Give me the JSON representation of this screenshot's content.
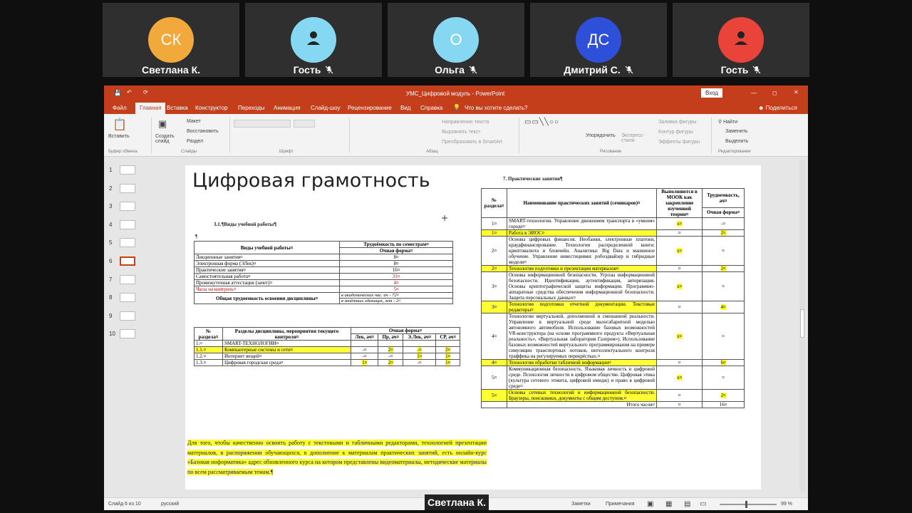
{
  "participants": [
    {
      "initials": "СК",
      "name": "Светлана К.",
      "color": "#f2a93b",
      "icon": "",
      "muted": false
    },
    {
      "initials": "",
      "name": "Гость",
      "color": "#86d8f2",
      "icon": "user-icon",
      "muted": true
    },
    {
      "initials": "О",
      "name": "Ольга",
      "color": "#86d8f2",
      "icon": "",
      "muted": true
    },
    {
      "initials": "ДС",
      "name": "Дмитрий С.",
      "color": "#2e4fd7",
      "icon": "",
      "muted": true
    },
    {
      "initials": "",
      "name": "Гость",
      "color": "#e9433a",
      "icon": "user-icon",
      "muted": true
    }
  ],
  "speaker_label": "Светлана К.",
  "ppt": {
    "title": "УМС_Цифровой модуль  -  PowerPoint",
    "login": "Вход",
    "menu": [
      "Файл",
      "Главная",
      "Вставка",
      "Конструктор",
      "Переходы",
      "Анимация",
      "Слайд-шоу",
      "Рецензирование",
      "Вид",
      "Справка"
    ],
    "tell_me": "Что вы хотите сделать?",
    "share": "Поделиться",
    "ribbon": {
      "paste": "Вставить",
      "clipboard": "Буфер обмена",
      "create_slide": "Создать слайд",
      "layout": "Макет",
      "reset": "Восстановить",
      "section": "Раздел",
      "slides": "Слайды",
      "font": "Шрифт",
      "text_dir": "Направление текста",
      "align_text": "Выровнять текст",
      "smartart": "Преобразовать в SmartArt",
      "paragraph": "Абзац",
      "arrange": "Упорядочить",
      "quick_styles": "Экспресс-стили",
      "fill": "Заливка фигуры",
      "outline": "Контур фигуры",
      "effects": "Эффекты фигуры",
      "drawing": "Рисование",
      "find": "Найти",
      "replace": "Заменить",
      "select": "Выделить",
      "editing": "Редактирование"
    },
    "slide_numbers": [
      "1",
      "2",
      "3",
      "4",
      "5",
      "6",
      "7",
      "8",
      "9",
      "10"
    ],
    "status": {
      "slide": "Слайд 6 из 10",
      "lang": "русский",
      "notes": "Заметки",
      "comments": "Примечания",
      "zoom": "99 %"
    }
  },
  "slide": {
    "title": "Цифровая грамотность",
    "sec31": "3.1.¶Виды учебной работы¶",
    "pilcrow": "¶",
    "t1": {
      "h1": "Виды учебной работы¤",
      "h2": "Трудоёмкость по семестрам¤",
      "h3": "Очная форма¤",
      "rows": [
        {
          "name": "Лекционные занятия¤",
          "val": "8¤"
        },
        {
          "name": "Электронная форма (ЭЛек)¤",
          "val": "8¤"
        },
        {
          "name": "Практические занятия¤",
          "val": "16¤"
        },
        {
          "name": "Самостоятельная работа¤",
          "val": "31¤"
        },
        {
          "name": "Промежуточная аттестация (зачет)¤",
          "val": "4¤"
        },
        {
          "name": "Часы на контроль¤",
          "val": "5¤"
        }
      ],
      "total": "Общая трудоемкость освоения дисциплины¤",
      "total_h": "в академических час. ач - 72¤",
      "total_z": "в зачётных единицах, зет - 2¤"
    },
    "t2": {
      "h_num": "№ раздела¤",
      "h_name": "Разделы дисциплины, мероприятия текущего контроля¤",
      "h_form": "Очная форма¤",
      "h_cols": [
        "Лек, ач¤",
        "Пр, ач¤",
        "Э.Лек, ач¤",
        "СР, ач¤"
      ],
      "rows": [
        {
          "n": "1.¤",
          "name": "SMART-ТЕХНОЛОГИИ¤",
          "v": [
            "",
            "",
            "",
            ""
          ]
        },
        {
          "n": "1.1.¤",
          "name": "Компьютерные системы и сети¤",
          "v": [
            "-¤",
            "2¤",
            "-¤",
            "2¤"
          ]
        },
        {
          "n": "1.2.¤",
          "name": "Интернет вещей¤",
          "v": [
            "-¤",
            "-¤",
            "1¤",
            "1¤"
          ]
        },
        {
          "n": "1.3.¤",
          "name": "Цифровая городская среда¤",
          "v": [
            "1¤",
            "2¤",
            "-¤",
            "1¤"
          ]
        }
      ]
    },
    "paragraph": "Для того, чтобы качественно освоить работу с текстовыми и табличными редакторами, технологией презентации материалов, в распоряжении обучающихся, в дополнение к материалам практических занятий, есть онлайн-курс «Базовая информатика» адрес обновленного курса на котором представлены видеоматериалы, методические материалы по всем рассматриваемым темам.¶",
    "sec7": "7. Практические занятия¶",
    "t3": {
      "h_num": "№ раздела¤",
      "h_name": "Наименование практических занятий (семинаров)¤",
      "h_mooc": "Выполняются в МООК как закрепление изученной теории¤",
      "h_lab": "Трудоемкость, ач¤",
      "h_form": "Очная форма¤",
      "rows": [
        {
          "n": "1¤",
          "text": "SMART-технологии. Управление движением транспорта в «умном» городе¤",
          "m": "x¤",
          "h": "-¤",
          "hl": false
        },
        {
          "n": "1¤",
          "text": "Работа в ЭИОС¤",
          "m": "¤",
          "h": "2¤",
          "hl": true
        },
        {
          "n": "2¤",
          "text": "Основы цифровых финансов. Необанки, электронные платежи, краудфинансирование. Технологии распределенной книги: криптовалюта и блокчейн. Аналитика: Big Data и машинное обучение. Управление инвестициями: робоэдвайзер и гибридные модели¤",
          "m": "x¤",
          "h": "¤",
          "hl": false
        },
        {
          "n": "2¤",
          "text": "Технологии подготовки и презентации материалов¤",
          "m": "¤",
          "h": "2¤",
          "hl": true
        },
        {
          "n": "3¤",
          "text": "Основы информационной безопасности. Угрозы информационной безопасности. Идентификация, аутентификация, авторизация. Основы криптографической защиты информации. Программно-аппаратные средства обеспечения информационной безопасности. Защита персональных данных¤",
          "m": "x¤",
          "h": "¤",
          "hl": false
        },
        {
          "n": "3¤",
          "text": "Технологии подготовки отчетной документации. Текстовые редакторы¤",
          "m": "¤",
          "h": "4¤",
          "hl": true
        },
        {
          "n": "4¤",
          "text": "Технологии виртуальной, дополненной и смешанной реальности. Управление в виртуальной среде малогабаритной моделью автономного автомобиля. Использование базовых возможностей VR-конструктора (на основе программного продукта «Виртуальная реальность», «Виртуальная лаборатория Газпром»). Использование базовых возможностей виртуального программирования на примере симуляции транспортных потоков, интеллектуального контроля траффика на регулируемых перекрёстках.¤",
          "m": "x¤",
          "h": "¤",
          "hl": false
        },
        {
          "n": "4¤",
          "text": "Технологии обработки табличной информации¤",
          "m": "¤",
          "h": "6¤",
          "hl": true
        },
        {
          "n": "5¤",
          "text": "Коммуникационная безопасность. Языковая личность в цифровой среде. Психология личности в цифровом обществе. Цифровая этика (культура сетевого этикета, цифровой имидж) и право в цифровой среде¤",
          "m": "x¤",
          "h": "¤",
          "hl": false
        },
        {
          "n": "5¤",
          "text": "Основы сетевых технологий и информационной безопасности. Браузеры, поисковики, документы с общим доступом.¤",
          "m": "¤",
          "h": "2¤",
          "hl": true
        }
      ],
      "total": "Итого часов¤",
      "total_m": "¤",
      "total_h": "16¤"
    }
  }
}
